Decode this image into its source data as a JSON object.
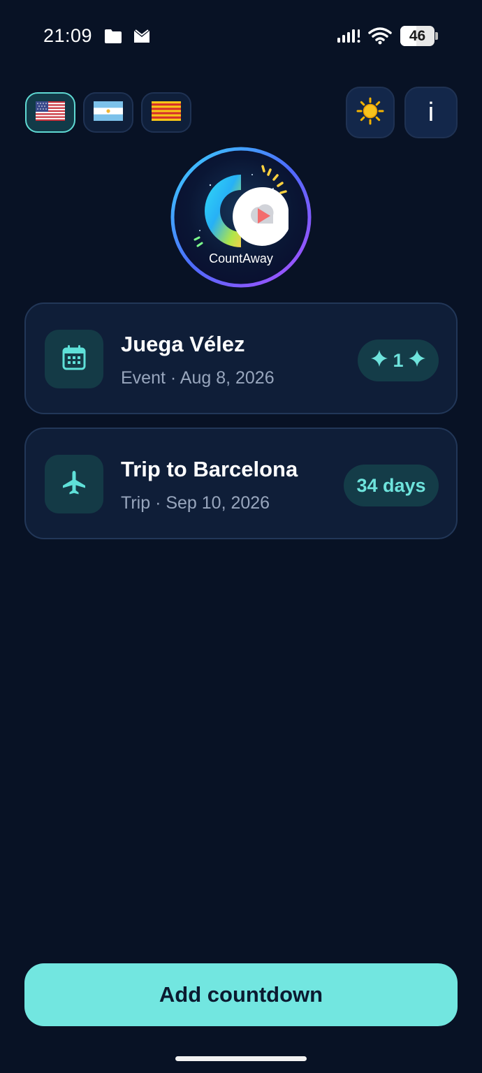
{
  "status_bar": {
    "time": "21:09",
    "battery": "46",
    "battery_level": 0.46,
    "icons": [
      "folder-icon",
      "mail-icon",
      "signal-icon",
      "wifi-icon",
      "battery-icon"
    ]
  },
  "language_flags": [
    {
      "name": "us-flag-icon",
      "selected": true
    },
    {
      "name": "argentina-flag-icon",
      "selected": false
    },
    {
      "name": "catalonia-flag-icon",
      "selected": false
    }
  ],
  "theme_button": {
    "icon": "sun-icon"
  },
  "info_button": {
    "label": "i"
  },
  "logo": {
    "text": "CountAway"
  },
  "countdowns": [
    {
      "icon": "calendar-icon",
      "title": "Juega Vélez",
      "subtitle": "Event · Aug 8, 2026",
      "badge": "1",
      "badge_icon": "sparkle-icon"
    },
    {
      "icon": "airplane-icon",
      "title": "Trip to Barcelona",
      "subtitle": "Trip · Sep 10, 2026",
      "badge": "34 days"
    }
  ],
  "add_button": {
    "label": "Add countdown"
  },
  "colors": {
    "background": "#081225",
    "card": "#0f1e38",
    "accent": "#72e6e0",
    "badge_text": "#6ee3dc",
    "icon_box": "#143a46"
  }
}
